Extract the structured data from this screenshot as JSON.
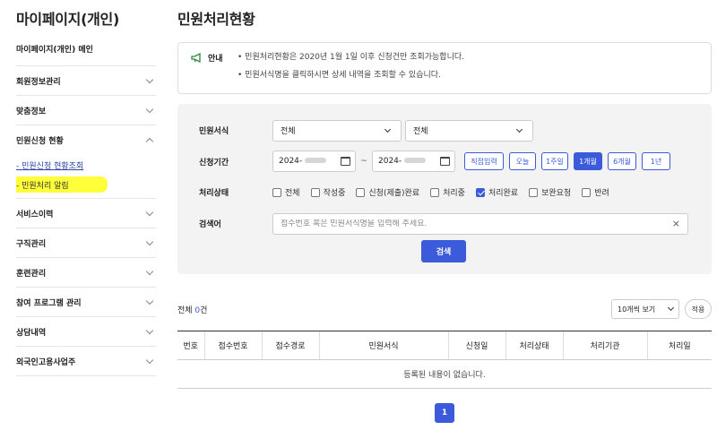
{
  "sidebar": {
    "title": "마이페이지(개인)",
    "items": [
      {
        "label": "마이페이지(개인) 메인"
      },
      {
        "label": "회원정보관리"
      },
      {
        "label": "맞춤정보"
      },
      {
        "label": "민원신청 현황",
        "sub": [
          "- 민원신청 현황조회",
          "- 민원처리 알림"
        ]
      },
      {
        "label": "서비스이력"
      },
      {
        "label": "구직관리"
      },
      {
        "label": "훈련관리"
      },
      {
        "label": "참여 프로그램 관리"
      },
      {
        "label": "상담내역"
      },
      {
        "label": "외국인고용사업주"
      }
    ],
    "highlight_color": "#ffff3a"
  },
  "main": {
    "title": "민원처리현황",
    "notice": {
      "label": "안내",
      "lines": [
        "• 민원처리현황은 2020년 1월 1일 이후 신청건만 조회가능합니다.",
        "• 민원서식명을 클릭하시면 상세 내역을 조회할 수 있습니다."
      ]
    },
    "filters": {
      "form_label": "민원서식",
      "form_select1": "전체",
      "form_select2": "전체",
      "period_label": "신청기간",
      "date_from": "2024-",
      "date_to": "2024-",
      "tilde": "~",
      "period_buttons": [
        "직접입력",
        "오늘",
        "1주일",
        "1개월",
        "6개월",
        "1년"
      ],
      "period_active": "1개월",
      "status_label": "처리상태",
      "statuses": [
        {
          "label": "전체",
          "checked": false
        },
        {
          "label": "작성중",
          "checked": false
        },
        {
          "label": "신청(제출)완료",
          "checked": false
        },
        {
          "label": "처리중",
          "checked": false
        },
        {
          "label": "처리완료",
          "checked": true
        },
        {
          "label": "보완요청",
          "checked": false
        },
        {
          "label": "반려",
          "checked": false
        }
      ],
      "keyword_label": "검색어",
      "keyword_placeholder": "접수번호 혹은 민원서식명을 입력해 주세요.",
      "clear_glyph": "×",
      "search_label": "검색"
    },
    "list": {
      "total_prefix": "전체 ",
      "total_count": "0",
      "total_suffix": "건",
      "page_size": "10개씩 보기",
      "apply_label": "적용",
      "columns": [
        "번호",
        "접수번호",
        "접수경로",
        "민원서식",
        "신청일",
        "처리상태",
        "처리기관",
        "처리일"
      ],
      "empty_message": "등록된 내용이 없습니다.",
      "current_page": "1"
    },
    "accent_color": "#3b5bdb"
  }
}
